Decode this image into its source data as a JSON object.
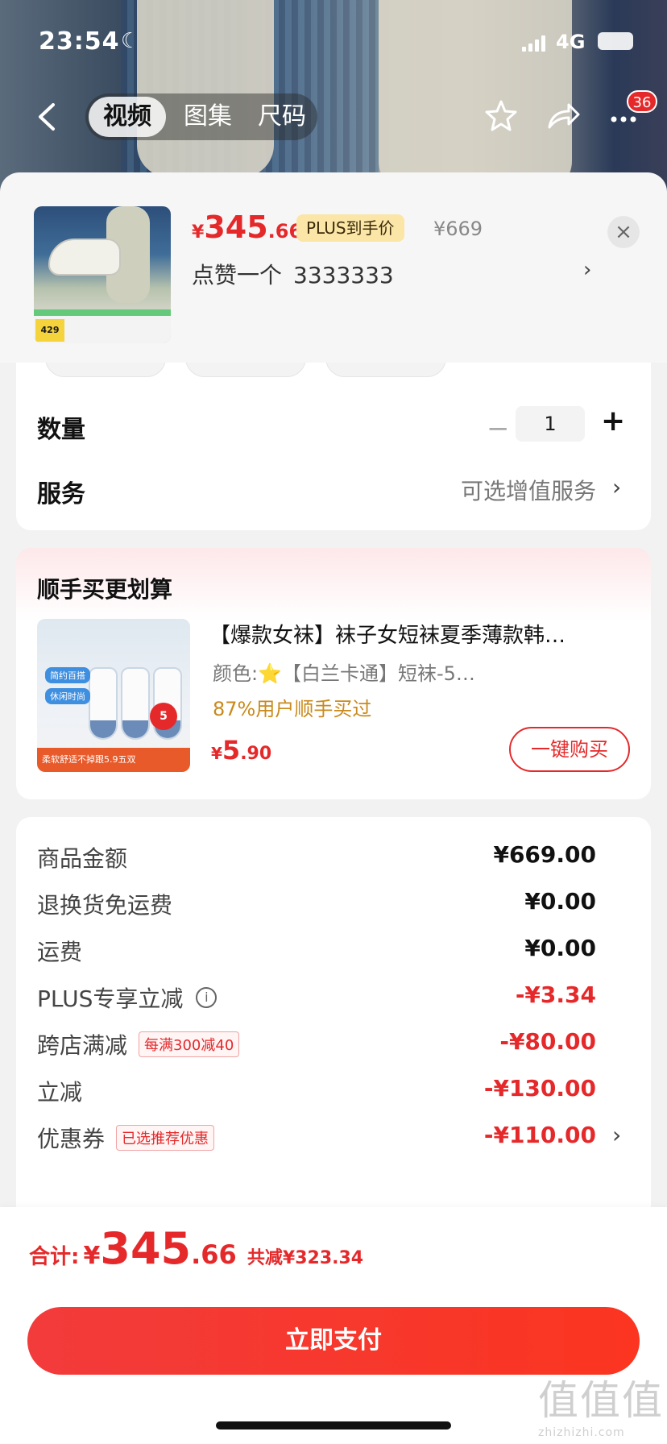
{
  "status_bar": {
    "time": "23:54",
    "network": "4G"
  },
  "nav": {
    "tabs": [
      "视频",
      "图集",
      "尺码"
    ],
    "badge_count": "36"
  },
  "product": {
    "currency": "¥",
    "price_int": "345",
    "price_dec": ".66",
    "plus_tag": "PLUS到手价",
    "original_price": "¥669",
    "spec": "点赞一个",
    "spec_value": "3333333",
    "thumb_price": "429"
  },
  "options": {
    "quantity_label": "数量",
    "quantity_value": "1",
    "service_label": "服务",
    "service_value": "可选增值服务"
  },
  "bundle": {
    "title": "顺手买更划算",
    "name": "【爆款女袜】袜子女短袜夏季薄款韩…",
    "color": "颜色:⭐【白兰卡通】短袜-5…",
    "rate": "87%用户顺手买过",
    "price_cur": "¥",
    "price_int": "5",
    "price_dec": ".90",
    "buy_label": "一键购买",
    "img_label_1": "简约百搭",
    "img_label_2": "休闲时尚",
    "img_bottom": "柔软舒适不掉跟5.9五双",
    "img_count": "5"
  },
  "summary": {
    "rows": [
      {
        "label": "商品金额",
        "value": "¥669.00",
        "red": false
      },
      {
        "label": "退换货免运费",
        "value": "¥0.00",
        "red": false
      },
      {
        "label": "运费",
        "value": "¥0.00",
        "red": false
      },
      {
        "label": "PLUS专享立减",
        "value": "-¥3.34",
        "red": true
      },
      {
        "label": "跨店满减",
        "value": "-¥80.00",
        "red": true,
        "tag": "每满300减40"
      },
      {
        "label": "立减",
        "value": "-¥130.00",
        "red": true
      },
      {
        "label": "优惠券",
        "value": "-¥110.00",
        "red": true,
        "tag": "已选推荐优惠"
      }
    ]
  },
  "footer": {
    "total_label": "合计:",
    "currency": "¥",
    "total_int": "345",
    "total_dec": ".66",
    "discount": "共减¥323.34",
    "pay_label": "立即支付"
  },
  "watermark": {
    "big": "值值值",
    "small": "zhizhizhi.com"
  },
  "colors": {
    "accent": "#e5292b",
    "plus_tag_bg": "#fbe6a8"
  },
  "icons": [
    "back-icon",
    "star-icon",
    "share-icon",
    "more-icon",
    "close-icon",
    "chevron-right-icon",
    "info-icon",
    "minus-icon",
    "plus-icon"
  ]
}
